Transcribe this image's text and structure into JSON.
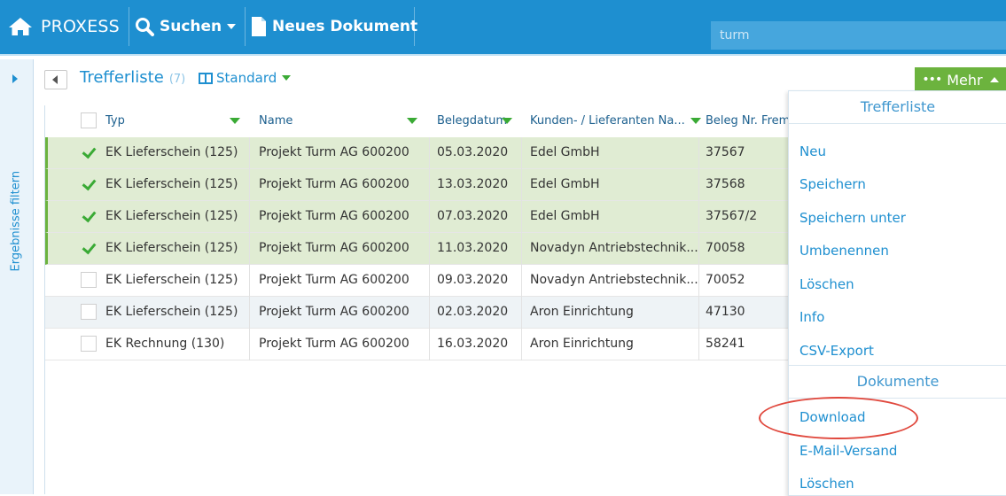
{
  "topbar": {
    "brand": "PROXESS",
    "search_label": "Suchen",
    "new_document_label": "Neues Dokument",
    "search_value": "turm"
  },
  "sidebar": {
    "filter_label": "Ergebnisse filtern"
  },
  "header": {
    "title": "Trefferliste",
    "count": "(7)",
    "view_label": "Standard",
    "more_label": "Mehr"
  },
  "table": {
    "columns": [
      "Typ",
      "Name",
      "Belegdatum",
      "Kunden- / Lieferanten Na...",
      "Beleg Nr. Frem"
    ],
    "rows": [
      {
        "typ": "EK Lieferschein (125)",
        "name": "Projekt Turm AG 600200",
        "datum": "05.03.2020",
        "kunde": "Edel GmbH",
        "nr": "37567",
        "selected": true
      },
      {
        "typ": "EK Lieferschein (125)",
        "name": "Projekt Turm AG 600200",
        "datum": "13.03.2020",
        "kunde": "Edel GmbH",
        "nr": "37568",
        "selected": true
      },
      {
        "typ": "EK Lieferschein (125)",
        "name": "Projekt Turm AG 600200",
        "datum": "07.03.2020",
        "kunde": "Edel GmbH",
        "nr": "37567/2",
        "selected": true
      },
      {
        "typ": "EK Lieferschein (125)",
        "name": "Projekt Turm AG 600200",
        "datum": "11.03.2020",
        "kunde": "Novadyn Antriebstechnik...",
        "nr": "70058",
        "selected": true
      },
      {
        "typ": "EK Lieferschein (125)",
        "name": "Projekt Turm AG 600200",
        "datum": "09.03.2020",
        "kunde": "Novadyn Antriebstechnik...",
        "nr": "70052",
        "selected": false
      },
      {
        "typ": "EK Lieferschein (125)",
        "name": "Projekt Turm AG 600200",
        "datum": "02.03.2020",
        "kunde": "Aron Einrichtung",
        "nr": "47130",
        "selected": false
      },
      {
        "typ": "EK Rechnung (130)",
        "name": "Projekt Turm AG 600200",
        "datum": "16.03.2020",
        "kunde": "Aron Einrichtung",
        "nr": "58241",
        "selected": false
      }
    ]
  },
  "menu": {
    "section1_title": "Trefferliste",
    "section1_items": [
      "Neu",
      "Speichern",
      "Speichern unter",
      "Umbenennen",
      "Löschen",
      "Info",
      "CSV-Export"
    ],
    "section2_title": "Dokumente",
    "section2_items": [
      "Download",
      "E-Mail-Versand",
      "Löschen"
    ]
  },
  "colors": {
    "primary": "#1e8fd0",
    "accent_green": "#6cb33e",
    "selected_row": "#e0ecd3",
    "highlight_oval": "#e0483d"
  }
}
